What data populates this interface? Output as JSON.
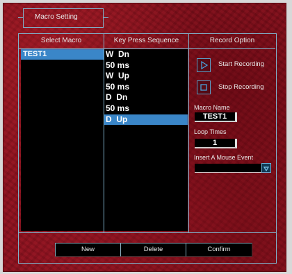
{
  "window": {
    "title": "Macro Setting"
  },
  "columns": {
    "select_macro": "Select Macro",
    "key_sequence": "Key Press Sequence",
    "record_option": "Record Option"
  },
  "macros": [
    {
      "label": "TEST1",
      "selected": true
    }
  ],
  "sequence": [
    {
      "label": "W  Dn",
      "selected": false
    },
    {
      "label": "50 ms",
      "selected": false
    },
    {
      "label": "W  Up",
      "selected": false
    },
    {
      "label": "50 ms",
      "selected": false
    },
    {
      "label": "D  Dn",
      "selected": false
    },
    {
      "label": "50 ms",
      "selected": false
    },
    {
      "label": "D  Up",
      "selected": true
    }
  ],
  "record": {
    "start_label": "Start Recording",
    "stop_label": "Stop Recording",
    "macro_name_label": "Macro Name",
    "macro_name_value": "TEST1",
    "loop_times_label": "Loop Times",
    "loop_times_value": "1",
    "mouse_event_label": "Insert A Mouse Event",
    "mouse_event_value": ""
  },
  "buttons": {
    "new": "New",
    "delete": "Delete",
    "confirm": "Confirm"
  },
  "colors": {
    "accent_line": "#7fb3cc",
    "selection": "#3a86c8",
    "background": "#8a1420"
  },
  "icons": {
    "start": "play-icon",
    "stop": "stop-icon",
    "dropdown": "chevron-down-icon"
  }
}
